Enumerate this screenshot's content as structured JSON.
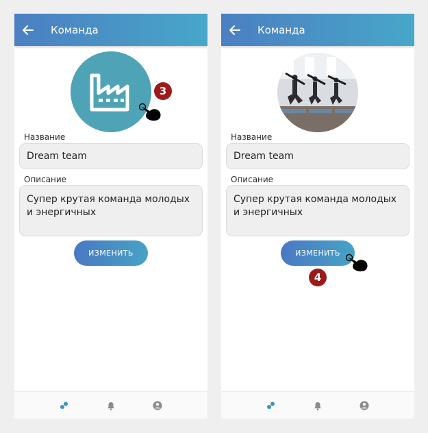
{
  "screens": [
    {
      "appbar": {
        "title": "Команда",
        "back_icon": "arrow-left-icon"
      },
      "avatar": {
        "type": "factory-icon",
        "color": "#4ea3b6"
      },
      "name_field": {
        "label": "Название",
        "value": "Dream team"
      },
      "description_field": {
        "label": "Описание",
        "value": "Супер крутая команда молодых и энергичных"
      },
      "action_button": {
        "label": "ИЗМЕНИТЬ"
      },
      "bottom_nav": [
        "team-icon",
        "bell-icon",
        "profile-icon"
      ],
      "step_marker": {
        "number": "3"
      }
    },
    {
      "appbar": {
        "title": "Команда",
        "back_icon": "arrow-left-icon"
      },
      "avatar": {
        "type": "photo",
        "description": "yoga-class-photo"
      },
      "name_field": {
        "label": "Название",
        "value": "Dream team"
      },
      "description_field": {
        "label": "Описание",
        "value": "Супер крутая команда молодых и энергичных"
      },
      "action_button": {
        "label": "ИЗМЕНИТЬ"
      },
      "bottom_nav": [
        "team-icon",
        "bell-icon",
        "profile-icon"
      ],
      "step_marker": {
        "number": "4"
      }
    }
  ],
  "colors": {
    "appbar_start": "#4b7fc2",
    "appbar_end": "#47a7c9",
    "button_start": "#4a78c3",
    "button_end": "#46a3c5",
    "nav_active": "#3a93c2",
    "nav_inactive": "#8a8a8a",
    "step_badge": "#9b1b1b"
  }
}
